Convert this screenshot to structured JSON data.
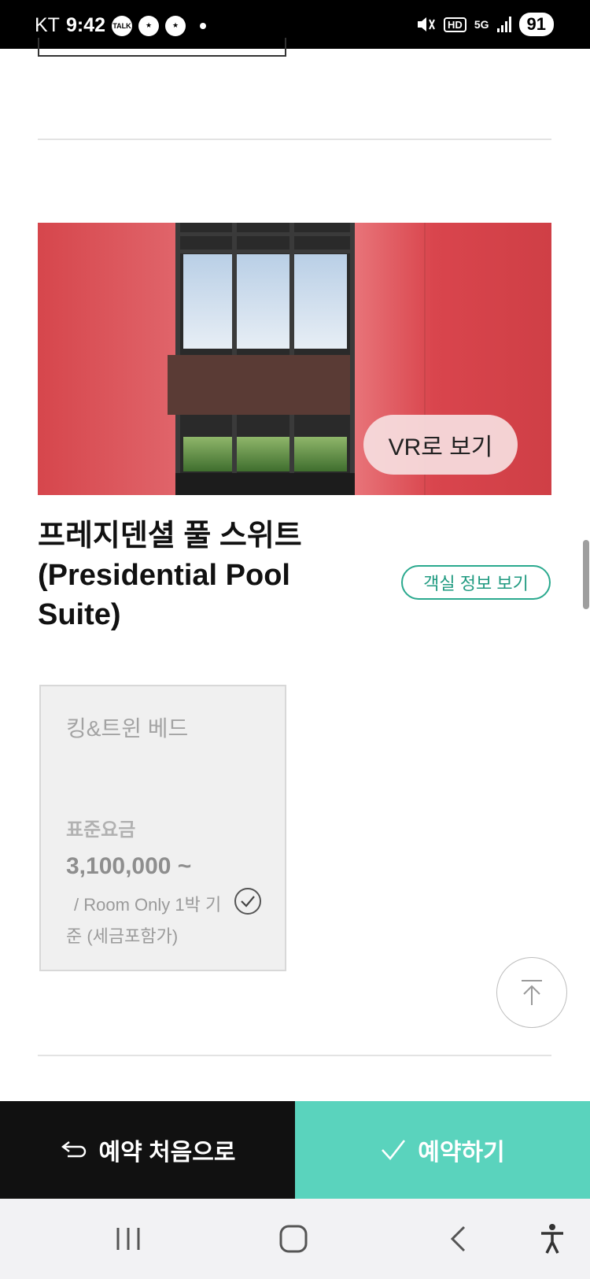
{
  "status_bar": {
    "carrier": "KT",
    "time": "9:42",
    "notification_icons": [
      "kakaotalk-icon",
      "starbucks-icon",
      "starbucks-icon"
    ],
    "network_hd": "HD",
    "network_type": "5G",
    "battery": "91"
  },
  "room": {
    "vr_button_label": "VR로 보기",
    "title": "프레지덴셜 풀 스위트 (Presidential Pool Suite)",
    "info_button_label": "객실 정보 보기"
  },
  "rate_card": {
    "bed_type": "킹&트윈 베드",
    "rate_label": "표준요금",
    "price": "3,100,000 ~",
    "price_desc": "/ Room Only 1박 기준 (세금포함가)",
    "selected": true
  },
  "action_bar": {
    "back_label": "예약 처음으로",
    "reserve_label": "예약하기",
    "reserve_color": "#5ad3bd",
    "back_color": "#111111"
  },
  "accent_color": "#2aa98e"
}
